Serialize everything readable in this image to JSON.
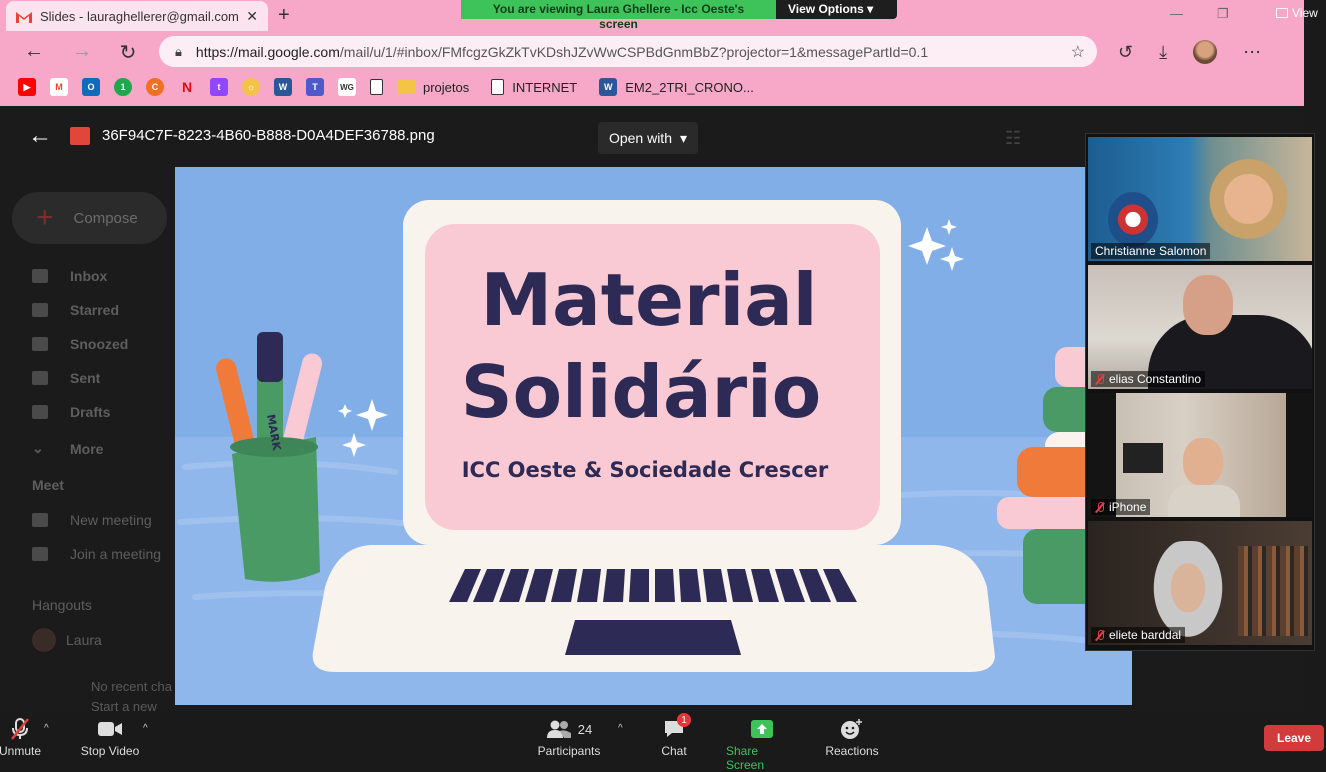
{
  "zoom_banner": {
    "message": "You are viewing Laura Ghellere - Icc Oeste's screen",
    "view_options": "View Options ▾"
  },
  "browser": {
    "tab_title": "Slides - lauraghellerer@gmail.com",
    "url_host": "https://mail.google.com",
    "url_path": "/mail/u/1/#inbox/FMfcgzGkZkTvKDshJZvWwCSPBdGnmBbZ?projector=1&messagePartId=0.1",
    "view_label": "View",
    "bookmarks": [
      "projetos",
      "INTERNET",
      "EM2_2TRI_CRONO..."
    ]
  },
  "gmail": {
    "compose": "Compose",
    "items": [
      "Inbox",
      "Starred",
      "Snoozed",
      "Sent",
      "Drafts",
      "More"
    ],
    "meet_header": "Meet",
    "meet_items": [
      "New meeting",
      "Join a meeting"
    ],
    "hangouts_header": "Hangouts",
    "hangouts_user": "Laura",
    "no_recent": "No recent cha",
    "start_new": "Start a new one"
  },
  "viewer": {
    "file_name": "36F94C7F-8223-4B60-B888-D0A4DEF36788.png",
    "open_with": "Open with"
  },
  "slide": {
    "title_line1": "Material",
    "title_line2": "Solidário",
    "subtitle": "ICC Oeste & Sociedade Crescer",
    "marker_text": "MARK",
    "colors": {
      "background": "#82aee8",
      "screen": "#f9c9d4",
      "laptop": "#f8f3ec",
      "ink": "#2d2a55",
      "cup": "#4a9a66",
      "orange": "#f07a3a"
    }
  },
  "participants": [
    {
      "name": "Christianne Salomon",
      "muted": false
    },
    {
      "name": "elias Constantino",
      "muted": true
    },
    {
      "name": "iPhone",
      "muted": true
    },
    {
      "name": "eliete barddal",
      "muted": true
    }
  ],
  "toolbar": {
    "unmute": "Unmute",
    "stop_video": "Stop Video",
    "participants_label": "Participants",
    "participants_count": "24",
    "chat": "Chat",
    "chat_badge": "1",
    "share_screen": "Share Screen",
    "reactions": "Reactions",
    "leave": "Leave"
  }
}
